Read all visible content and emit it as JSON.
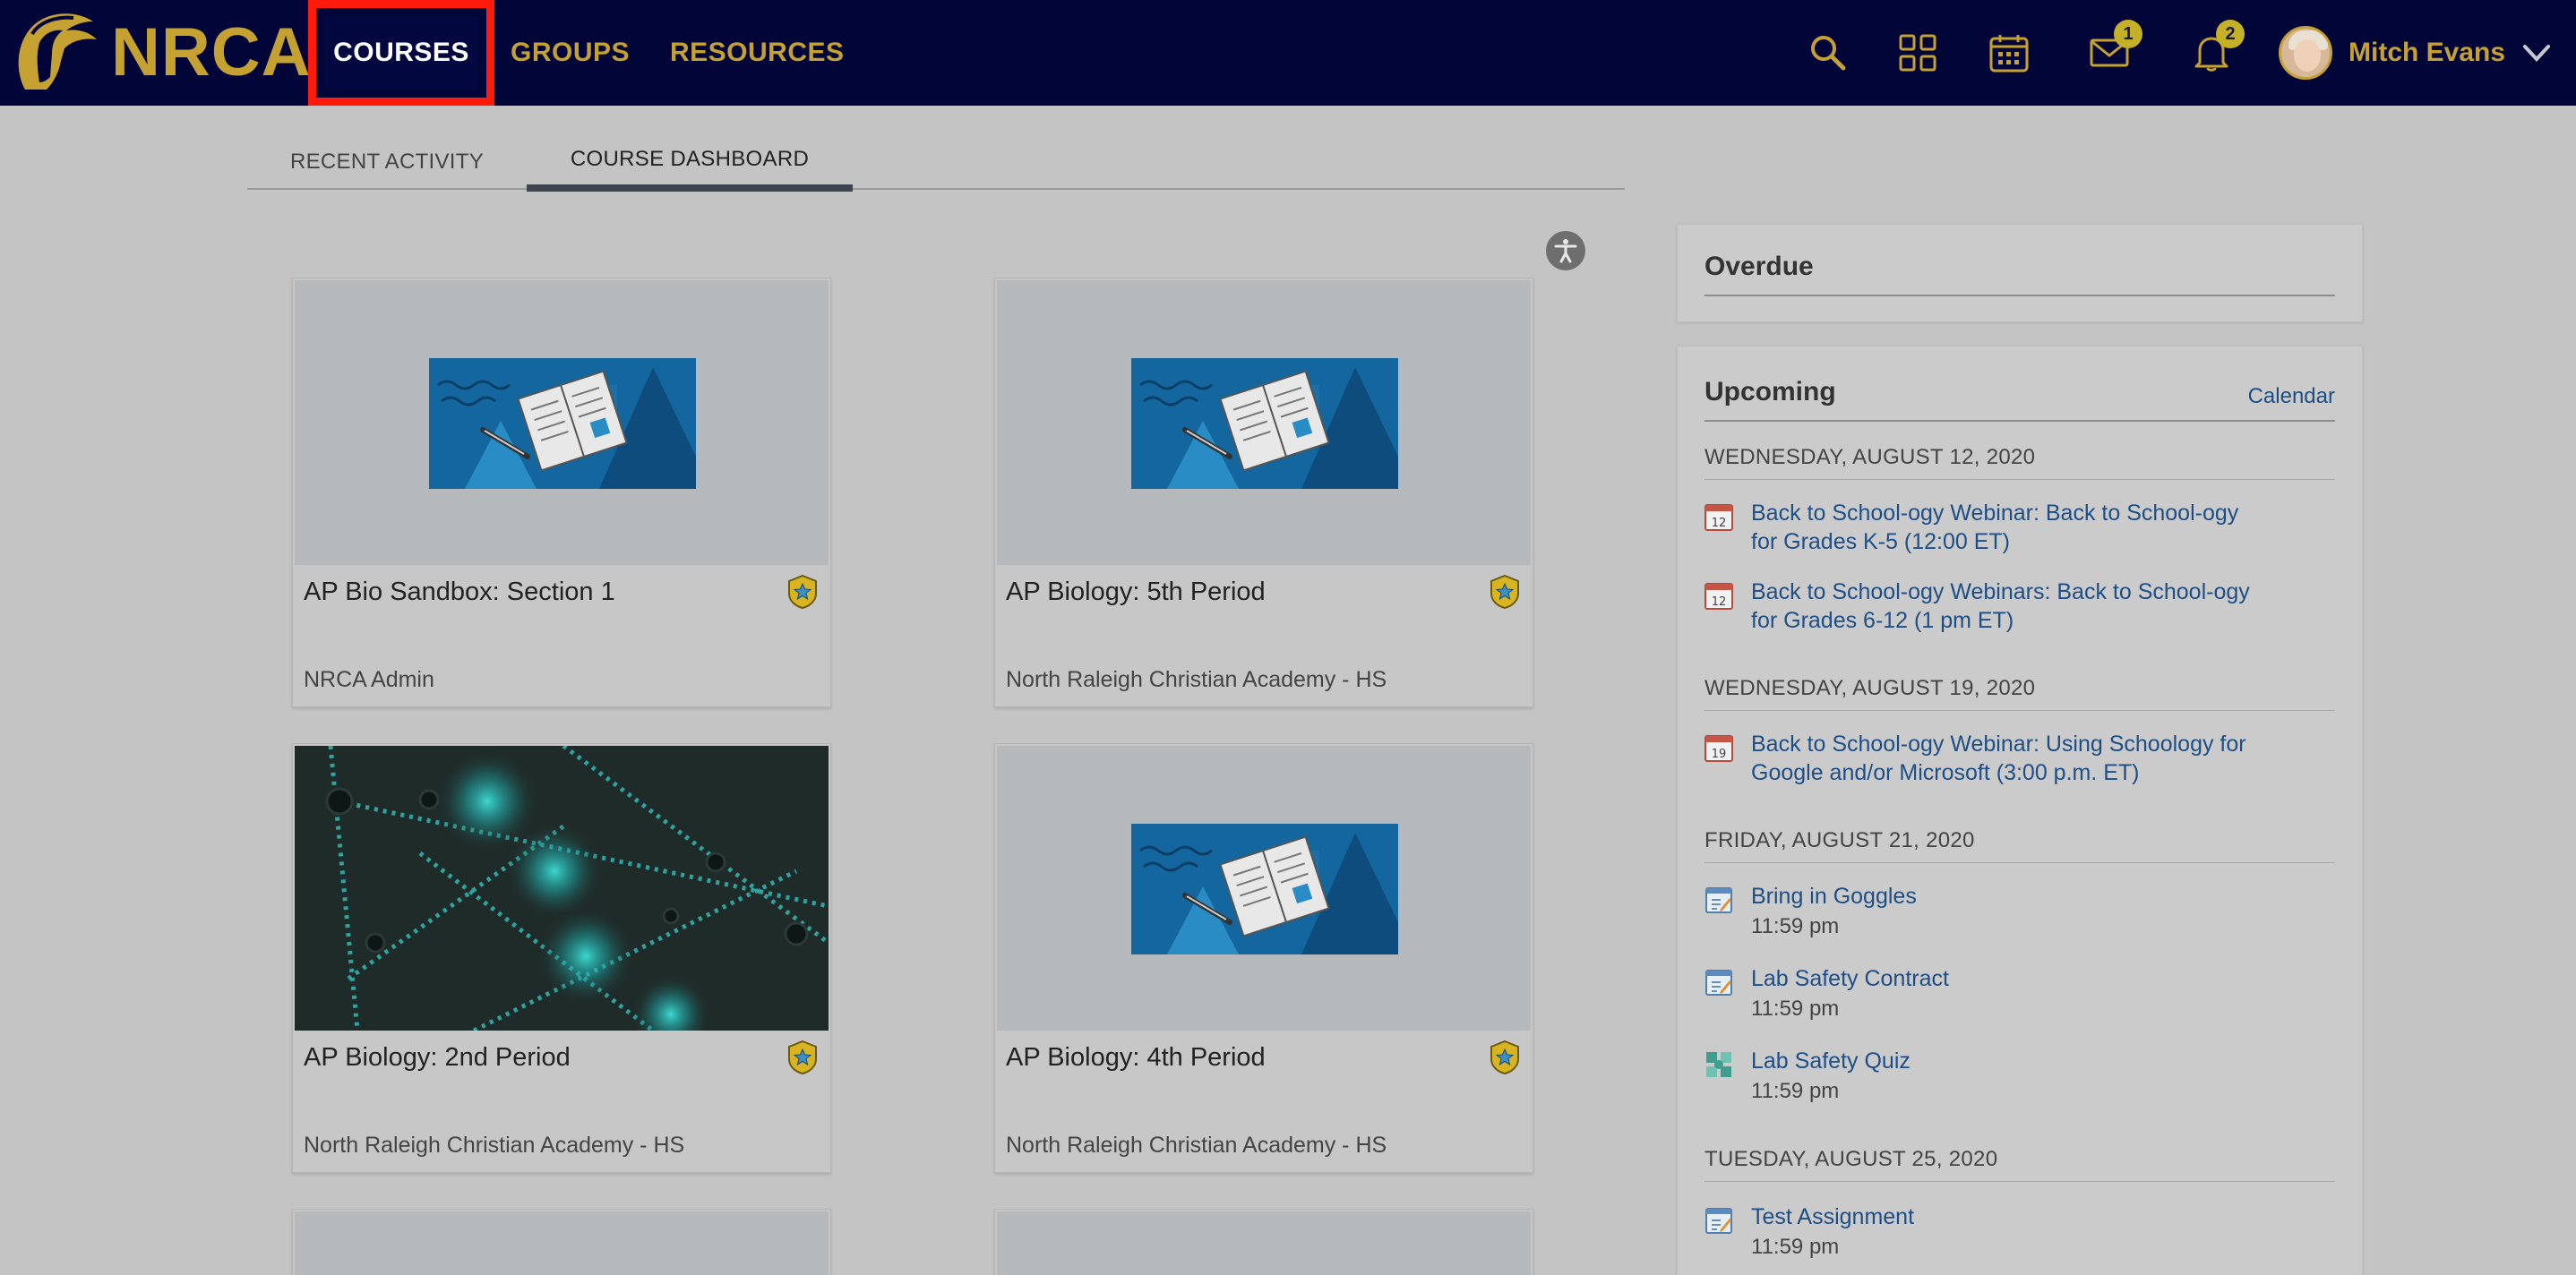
{
  "brand": {
    "name": "NRCA",
    "logo_icon": "spartan-helmet-logo"
  },
  "nav": {
    "items": [
      {
        "label": "COURSES",
        "active": true
      },
      {
        "label": "GROUPS"
      },
      {
        "label": "RESOURCES"
      }
    ]
  },
  "toolbar": {
    "icons": [
      "search-icon",
      "apps-grid-icon",
      "calendar-icon",
      "messages-icon",
      "notifications-icon"
    ],
    "messages_count": "1",
    "notifications_count": "2"
  },
  "user": {
    "name": "Mitch Evans"
  },
  "tabs": [
    {
      "label": "RECENT ACTIVITY"
    },
    {
      "label": "COURSE DASHBOARD",
      "active": true
    }
  ],
  "courses": [
    {
      "title": "AP Bio Sandbox: Section 1",
      "org": "NRCA Admin",
      "image": "book-illustration"
    },
    {
      "title": "AP Biology: 5th Period",
      "org": "North Raleigh Christian Academy - HS",
      "image": "book-illustration"
    },
    {
      "title": "AP Biology: 2nd Period",
      "org": "North Raleigh Christian Academy - HS",
      "image": "molecule-photo"
    },
    {
      "title": "AP Biology: 4th Period",
      "org": "North Raleigh Christian Academy - HS",
      "image": "book-illustration"
    }
  ],
  "overdue": {
    "title": "Overdue"
  },
  "upcoming": {
    "title": "Upcoming",
    "calendar_link": "Calendar",
    "groups": [
      {
        "date": "WEDNESDAY, AUGUST 12, 2020",
        "events": [
          {
            "icon": "calendar-event-icon",
            "day": "12",
            "line1": "Back to School-ogy Webinar: Back to School-ogy",
            "line2": "for Grades K-5 (12:00 ET)"
          },
          {
            "icon": "calendar-event-icon",
            "day": "12",
            "line1": "Back to School-ogy Webinars: Back to School-ogy",
            "line2": "for Grades 6-12 (1 pm ET)"
          }
        ]
      },
      {
        "date": "WEDNESDAY, AUGUST 19, 2020",
        "events": [
          {
            "icon": "calendar-event-icon",
            "day": "19",
            "line1": "Back to School-ogy Webinar: Using Schoology for",
            "line2": "Google and/or Microsoft (3:00 p.m. ET)"
          }
        ]
      },
      {
        "date": "FRIDAY, AUGUST 21, 2020",
        "events": [
          {
            "icon": "assignment-icon",
            "line1": "Bring in Goggles",
            "time": "11:59 pm"
          },
          {
            "icon": "assignment-icon",
            "line1": "Lab Safety Contract",
            "time": "11:59 pm"
          },
          {
            "icon": "quiz-icon",
            "line1": "Lab Safety Quiz",
            "time": "11:59 pm"
          }
        ]
      },
      {
        "date": "TUESDAY, AUGUST 25, 2020",
        "events": [
          {
            "icon": "assignment-icon",
            "line1": "Test Assignment",
            "time": "11:59 pm"
          }
        ]
      }
    ]
  },
  "colors": {
    "navbar": "#010538",
    "brand_gold": "#c5a131",
    "highlight_box": "#ff1a0b",
    "link_blue": "#1e4e86",
    "overlay_gray": "#c4c4c4"
  }
}
